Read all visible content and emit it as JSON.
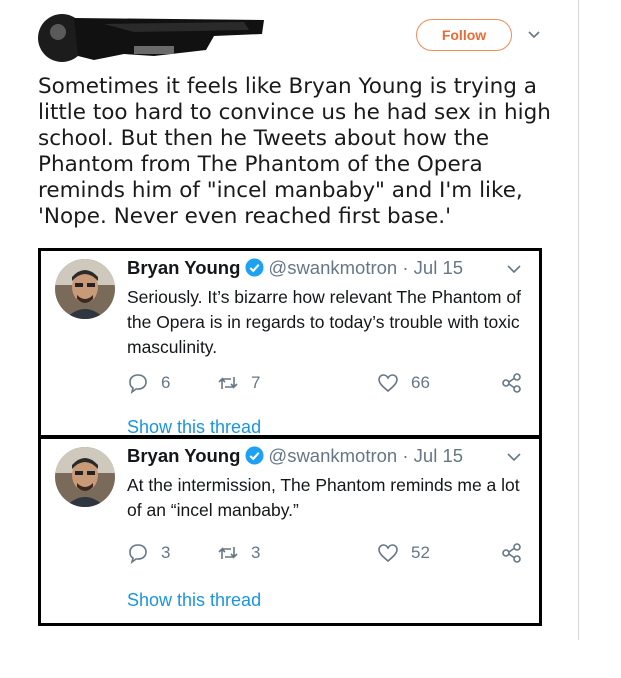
{
  "header": {
    "follow_label": "Follow",
    "follow_color": "#e96a34"
  },
  "post": {
    "text": "Sometimes it feels like Bryan Young is trying a little too hard to convince us he had sex in high school. But then he Tweets about how the Phantom from The Phantom of the Opera reminds him of \"incel manbaby\" and I'm like, 'Nope. Never even reached first base.'"
  },
  "tweets": [
    {
      "name": "Bryan Young",
      "handle": "@swankmotron",
      "date": "· Jul 15",
      "text": "Seriously. It’s bizarre how relevant The Phantom of the Opera is in regards to today’s trouble with toxic masculinity.",
      "replies": "6",
      "retweets": "7",
      "likes": "66",
      "show_thread": "Show this thread"
    },
    {
      "name": "Bryan Young",
      "handle": "@swankmotron",
      "date": "· Jul 15",
      "text": "At the intermission, The Phantom reminds me a lot of an “incel manbaby.”",
      "replies": "3",
      "retweets": "3",
      "likes": "52",
      "show_thread": "Show this thread"
    }
  ],
  "colors": {
    "link": "#1b95e0",
    "meta": "#657786",
    "verified": "#1da1f2"
  }
}
